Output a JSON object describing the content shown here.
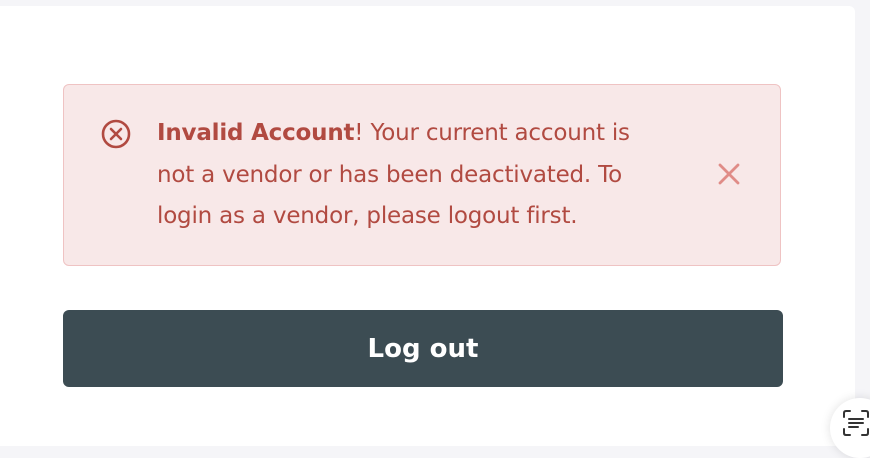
{
  "alert": {
    "title": "Invalid Account",
    "bang": "!",
    "message": " Your current account is not a vendor or has been deactivated. To login as a vendor, please logout first.",
    "icon": "error-circle-x-icon",
    "close_icon": "close-icon",
    "color": "#b14a41",
    "background": "#f8e8e8"
  },
  "actions": {
    "logout_label": "Log out",
    "button_color": "#3c4c53"
  },
  "floating": {
    "icon": "scan-text-icon"
  }
}
